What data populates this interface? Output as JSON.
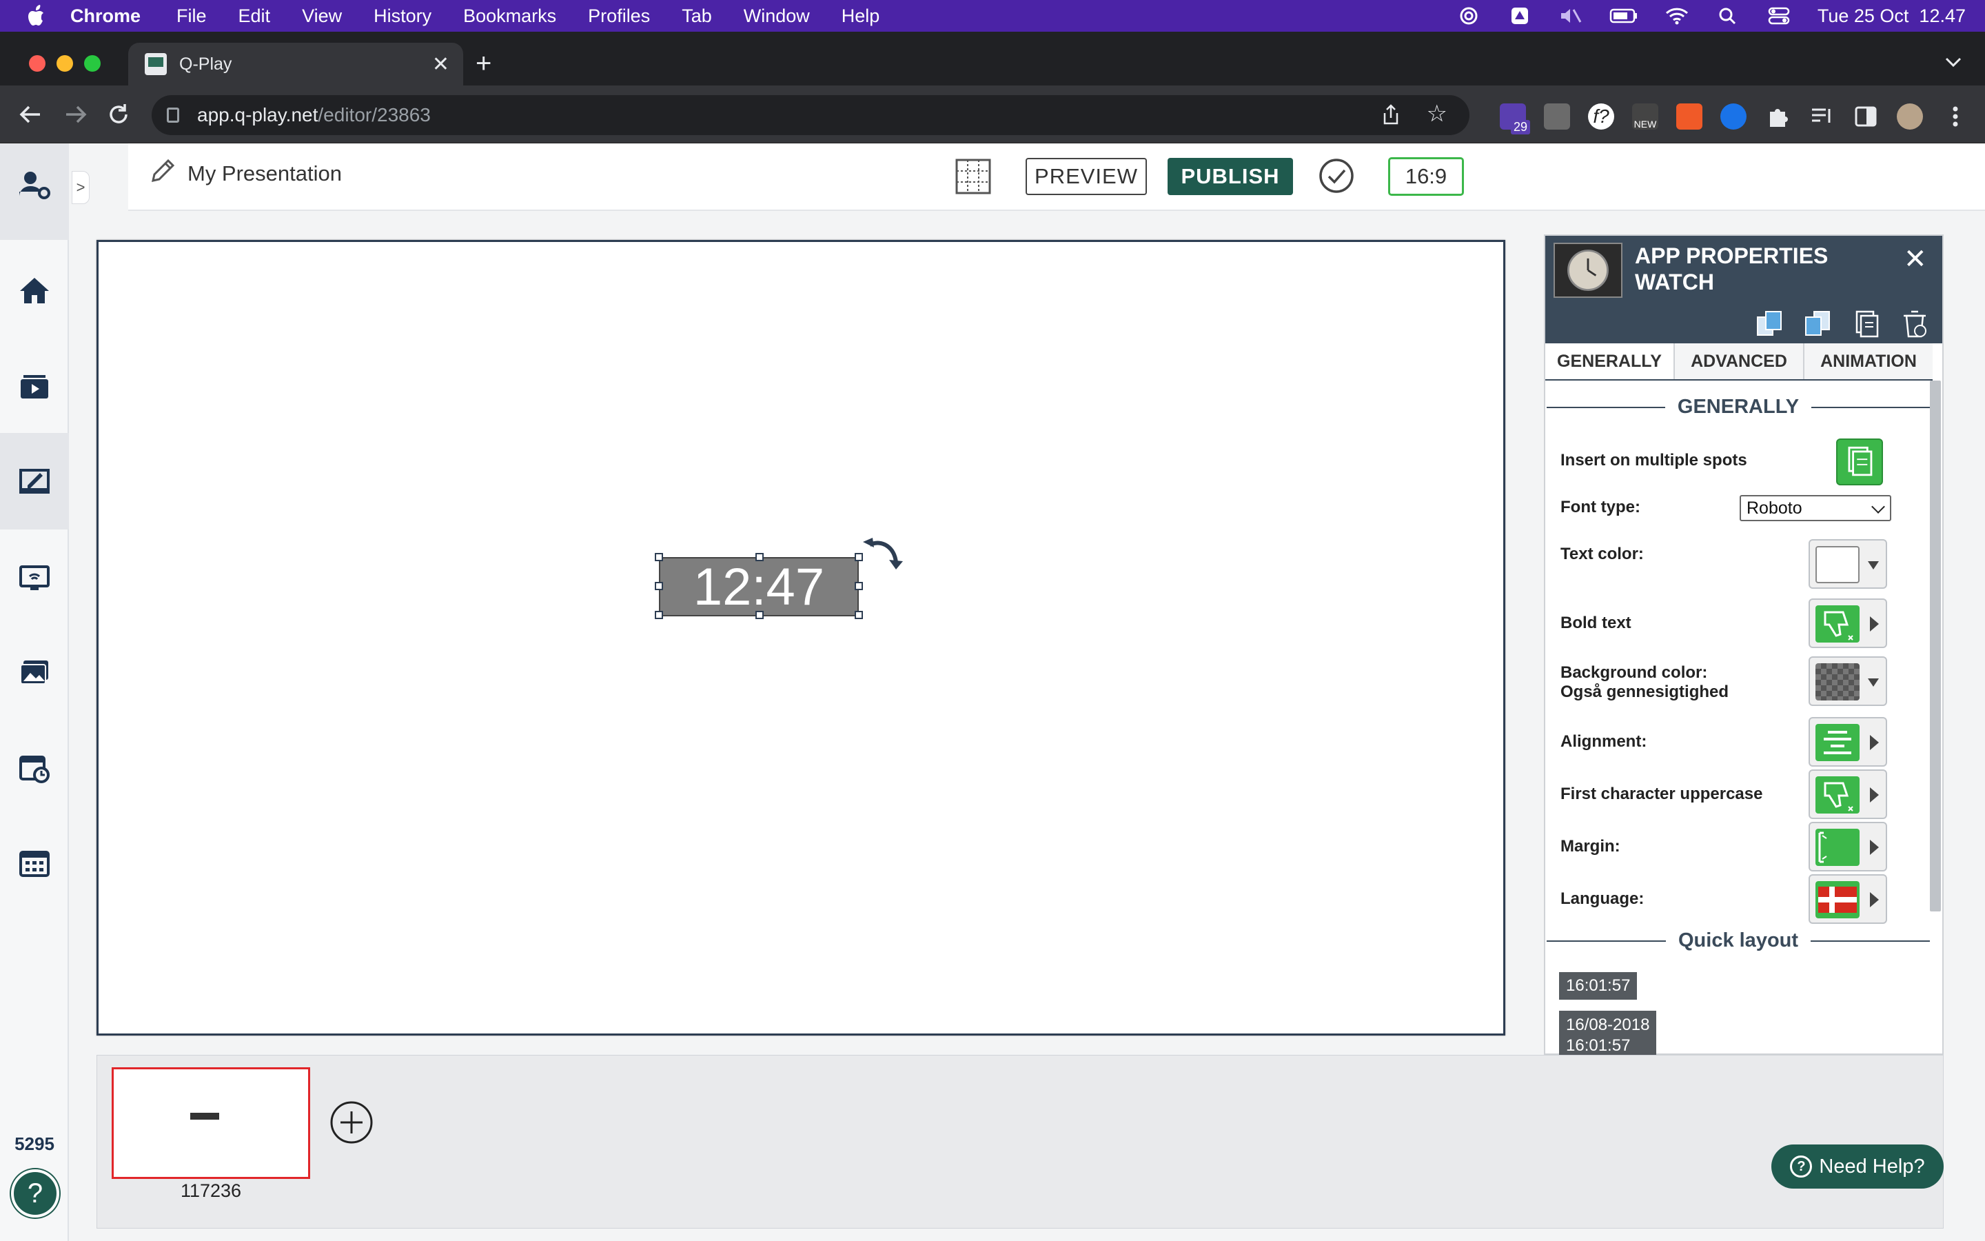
{
  "menubar": {
    "app": "Chrome",
    "items": [
      "File",
      "Edit",
      "View",
      "History",
      "Bookmarks",
      "Profiles",
      "Tab",
      "Window",
      "Help"
    ],
    "clock": "Tue 25 Oct  12.47"
  },
  "browser": {
    "tab_title": "Q-Play",
    "url_host": "app.q-play.net",
    "url_path": "/editor/23863",
    "extension_badge": "29"
  },
  "editor": {
    "title": "My Presentation",
    "preview_label": "PREVIEW",
    "publish_label": "PUBLISH",
    "ratio_label": "16:9"
  },
  "canvas": {
    "watch_time": "12:47"
  },
  "slides": {
    "thumb_id": "117236"
  },
  "sidebar": {
    "counter": "5295"
  },
  "help": {
    "label": "Need Help?"
  },
  "panel": {
    "title_line1": "APP PROPERTIES",
    "title_line2": "WATCH",
    "tabs": [
      "GENERALLY",
      "ADVANCED",
      "ANIMATION"
    ],
    "section_generally": "GENERALLY",
    "section_quick": "Quick layout",
    "labels": {
      "insert": "Insert on multiple spots",
      "font_type": "Font type:",
      "text_color": "Text color:",
      "bold": "Bold text",
      "bg_color": "Background color:",
      "bg_color_sub": "Også gennesigtighed",
      "alignment": "Alignment:",
      "first_upper": "First character uppercase",
      "margin": "Margin:",
      "language": "Language:"
    },
    "font_value": "Roboto",
    "quick_layouts": [
      "16:01:57",
      "16/08-2018",
      "16:01:57"
    ]
  },
  "colors": {
    "menubar": "#4b23a6",
    "brand": "#1f5a4e",
    "accent_green": "#3cb74a",
    "panel_header": "#3a4a5a"
  }
}
